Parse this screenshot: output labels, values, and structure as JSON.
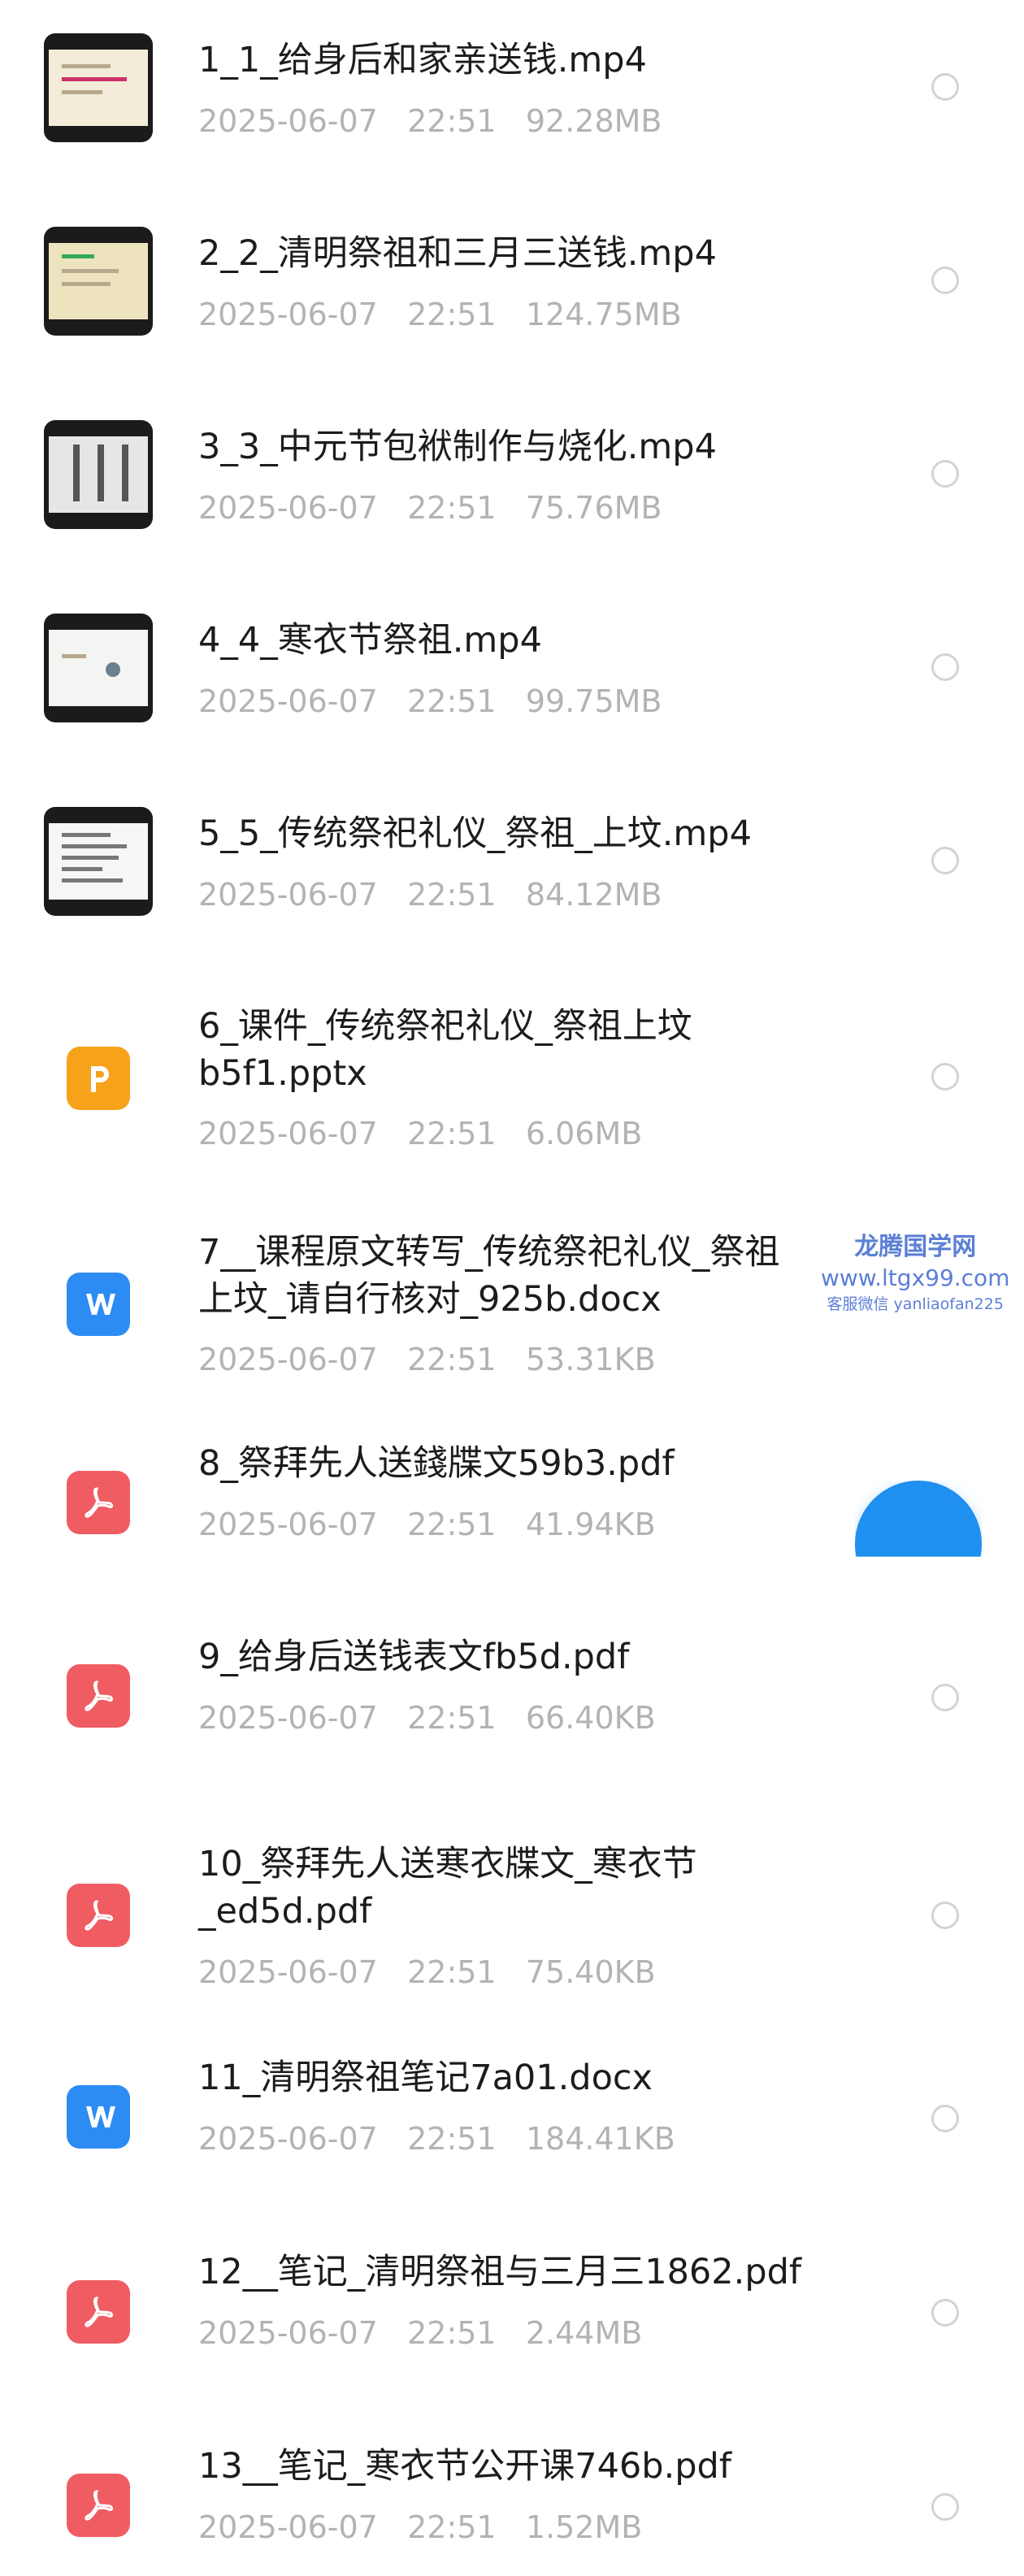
{
  "files": [
    {
      "title": "1_1_给身后和家亲送钱.mp4",
      "date": "2025-06-07",
      "time": "22:51",
      "size": "92.28MB",
      "icon": "video-thumbnail"
    },
    {
      "title": "2_2_清明祭祖和三月三送钱.mp4",
      "date": "2025-06-07",
      "time": "22:51",
      "size": "124.75MB",
      "icon": "video-thumbnail"
    },
    {
      "title": "3_3_中元节包袱制作与烧化.mp4",
      "date": "2025-06-07",
      "time": "22:51",
      "size": "75.76MB",
      "icon": "video-thumbnail"
    },
    {
      "title": "4_4_寒衣节祭祖.mp4",
      "date": "2025-06-07",
      "time": "22:51",
      "size": "99.75MB",
      "icon": "video-thumbnail"
    },
    {
      "title": "5_5_传统祭祀礼仪_祭祖_上坟.mp4",
      "date": "2025-06-07",
      "time": "22:51",
      "size": "84.12MB",
      "icon": "video-thumbnail"
    },
    {
      "title": "6_课件_传统祭祀礼仪_祭祖上坟",
      "title2": "b5f1.pptx",
      "date": "2025-06-07",
      "time": "22:51",
      "size": "6.06MB",
      "icon": "pptx-icon"
    },
    {
      "title": "7__课程原文转写_传统祭祀礼仪_祭祖",
      "title2": "上坟_请自行核对_925b.docx",
      "date": "2025-06-07",
      "time": "22:51",
      "size": "53.31KB",
      "icon": "docx-icon"
    },
    {
      "title": "8_祭拜先人送錢牒文59b3.pdf",
      "date": "2025-06-07",
      "time": "22:51",
      "size": "41.94KB",
      "icon": "pdf-icon"
    },
    {
      "title": "9_给身后送钱表文fb5d.pdf",
      "date": "2025-06-07",
      "time": "22:51",
      "size": "66.40KB",
      "icon": "pdf-icon"
    },
    {
      "title": "10_祭拜先人送寒衣牒文_寒衣节",
      "title2": "_ed5d.pdf",
      "date": "2025-06-07",
      "time": "22:51",
      "size": "75.40KB",
      "icon": "pdf-icon"
    },
    {
      "title": "11_清明祭祖笔记7a01.docx",
      "date": "2025-06-07",
      "time": "22:51",
      "size": "184.41KB",
      "icon": "docx-icon"
    },
    {
      "title": "12__笔记_清明祭祖与三月三1862.pdf",
      "date": "2025-06-07",
      "time": "22:51",
      "size": "2.44MB",
      "icon": "pdf-icon"
    },
    {
      "title": "13__笔记_寒衣节公开课746b.pdf",
      "date": "2025-06-07",
      "time": "22:51",
      "size": "1.52MB",
      "icon": "pdf-icon"
    }
  ],
  "watermark": {
    "name": "龙腾国学网",
    "url": "www.ltgx99.com",
    "contact": "客服微信 yanliaofan225"
  },
  "colors": {
    "pptx": "#f7a21b",
    "docx": "#2c8cf4",
    "pdf": "#ef5d62",
    "fab": "#1f8ff0"
  }
}
